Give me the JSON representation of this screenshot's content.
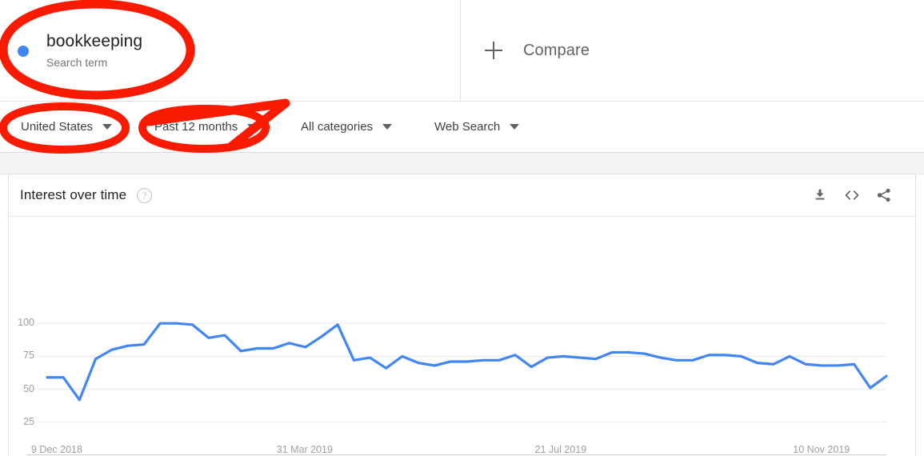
{
  "terms": [
    {
      "title": "bookkeeping",
      "subtitle": "Search term",
      "color": "#4285f4"
    }
  ],
  "compare": {
    "label": "Compare",
    "icon": "plus-icon"
  },
  "filters": [
    {
      "name": "region",
      "label": "United States"
    },
    {
      "name": "time",
      "label": "Past 12 months"
    },
    {
      "name": "category",
      "label": "All categories"
    },
    {
      "name": "property",
      "label": "Web Search"
    }
  ],
  "card": {
    "title": "Interest over time",
    "help_icon": "help-circle-icon",
    "actions": [
      {
        "name": "download",
        "icon": "download-icon"
      },
      {
        "name": "embed",
        "icon": "code-embed-icon"
      },
      {
        "name": "share",
        "icon": "share-icon"
      }
    ]
  },
  "annotations": {
    "color": "#f91a00",
    "items": [
      {
        "name": "annotation-oval-search-term",
        "shape": "ellipse"
      },
      {
        "name": "annotation-oval-region",
        "shape": "ellipse"
      },
      {
        "name": "annotation-oval-timerange",
        "shape": "ellipse-with-arrow"
      }
    ]
  },
  "chart_data": {
    "type": "line",
    "title": "Interest over time",
    "xlabel": "",
    "ylabel": "",
    "ylim": [
      0,
      108
    ],
    "yticks": [
      25,
      50,
      75,
      100
    ],
    "ytick_labels": [
      "25",
      "50",
      "75",
      "100"
    ],
    "xticks": [
      "9 Dec 2018",
      "31 Mar 2019",
      "21 Jul 2019",
      "10 Nov 2019"
    ],
    "xtick_positions": [
      0,
      16,
      32,
      48
    ],
    "grid": true,
    "legend": "none",
    "series": [
      {
        "name": "bookkeeping",
        "color": "#4285f4",
        "values": [
          59,
          59,
          42,
          73,
          80,
          83,
          84,
          100,
          100,
          99,
          89,
          91,
          79,
          81,
          81,
          85,
          82,
          90,
          99,
          72,
          74,
          66,
          75,
          70,
          68,
          71,
          71,
          72,
          72,
          76,
          67,
          74,
          75,
          74,
          73,
          78,
          78,
          77,
          74,
          72,
          72,
          76,
          76,
          75,
          70,
          69,
          75,
          69,
          68,
          68,
          69,
          51,
          60
        ]
      }
    ]
  }
}
